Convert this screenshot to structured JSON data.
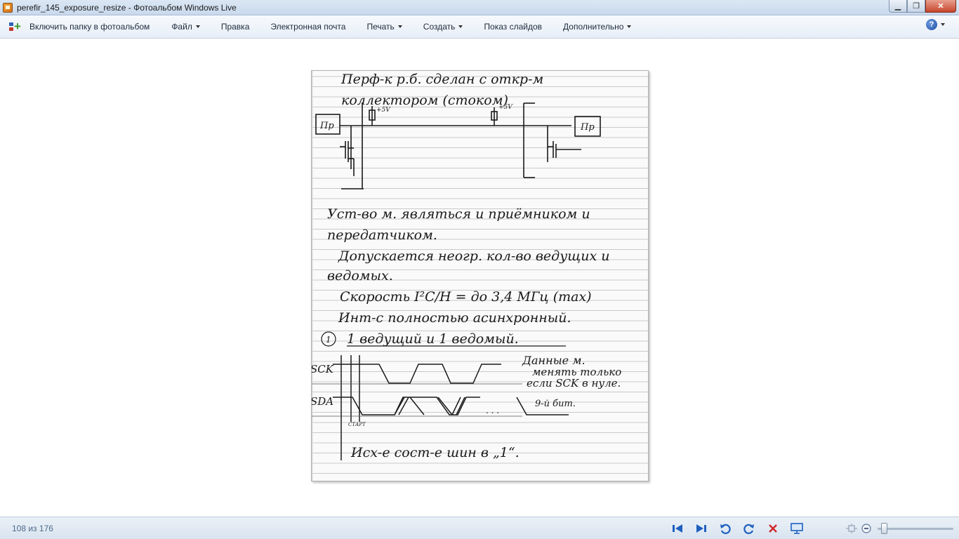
{
  "window": {
    "title": "perefir_145_exposure_resize - Фотоальбом Windows Live",
    "minimize_glyph": "▁",
    "maximize_glyph": "❐",
    "close_glyph": "✕"
  },
  "menubar": {
    "include_folder": "Включить папку в фотоальбом",
    "items": [
      {
        "label": "Файл",
        "dropdown": true
      },
      {
        "label": "Правка",
        "dropdown": false
      },
      {
        "label": "Электронная почта",
        "dropdown": false
      },
      {
        "label": "Печать",
        "dropdown": true
      },
      {
        "label": "Создать",
        "dropdown": true
      },
      {
        "label": "Показ слайдов",
        "dropdown": false
      },
      {
        "label": "Дополнительно",
        "dropdown": true
      }
    ],
    "help_glyph": "?"
  },
  "photo": {
    "line1": "Перф-к р.б. сделан с откр-м",
    "line2": "коллектором (стоком)",
    "label_pr_left": "Пр",
    "label_pr_right": "Пр",
    "label_5v_1": "+5V",
    "label_5v_2": "+5V",
    "text1": "Уст-во м. являться и приёмником и",
    "text2": "передатчиком.",
    "text3": "Допускается неогр. кол-во ведущих и",
    "text4": "ведомых.",
    "text5": "Скорость I²C/H = до 3,4 МГц (max)",
    "text6": "Инт-с полностью асинхронный.",
    "text7_num": "1",
    "text7": "1 ведущий и 1 ведомый.",
    "sck": "SCK",
    "sda": "SDA",
    "start": "СТАРТ",
    "note1": "Данные м.",
    "note2": "менять только",
    "note3": "если SCK в нуле.",
    "bit9": "9-й бит.",
    "dots": ". . .",
    "bottom": "Исх-е сост-е шин в „1“."
  },
  "status": {
    "counter": "108 из 176",
    "zoom_level": 0.05
  },
  "colors": {
    "nav_blue": "#1f5fbf",
    "delete_red": "#d0262a",
    "ink": "#1a1a1a"
  }
}
